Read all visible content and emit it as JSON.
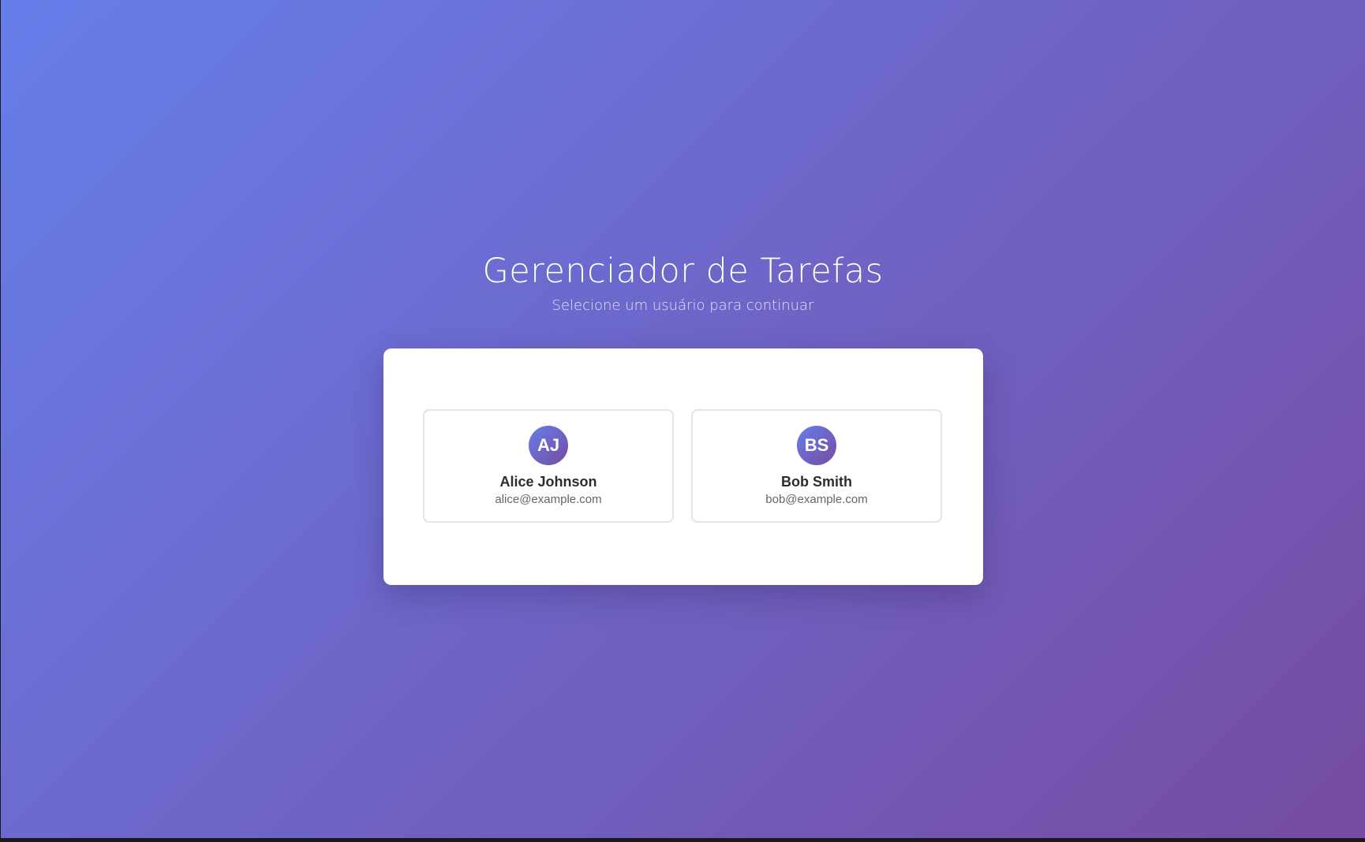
{
  "header": {
    "title": "Gerenciador de Tarefas",
    "subtitle": "Selecione um usuário para continuar"
  },
  "users": [
    {
      "initials": "AJ",
      "name": "Alice Johnson",
      "email": "alice@example.com"
    },
    {
      "initials": "BS",
      "name": "Bob Smith",
      "email": "bob@example.com"
    }
  ],
  "colors": {
    "gradient_start": "#667eea",
    "gradient_end": "#764ba2",
    "card_border": "#e3e3e8",
    "name_text": "#2d2d2d",
    "email_text": "#666666"
  }
}
